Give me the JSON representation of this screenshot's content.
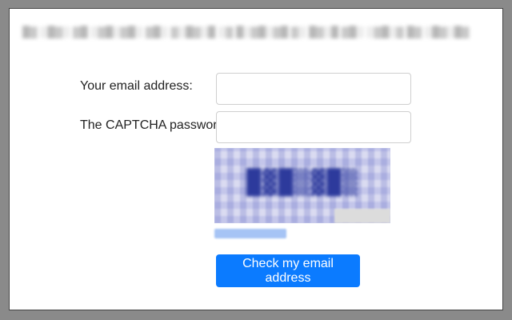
{
  "form": {
    "email_label": "Your email address:",
    "email_value": "",
    "captcha_label": "The CAPTCHA password:",
    "captcha_value": "",
    "submit_label": "Check my email address"
  },
  "colors": {
    "button": "#0b7bff",
    "captcha_bg": "#c9cbeb",
    "captcha_text": "#2d3a9c",
    "link": "#a6c4f5"
  }
}
